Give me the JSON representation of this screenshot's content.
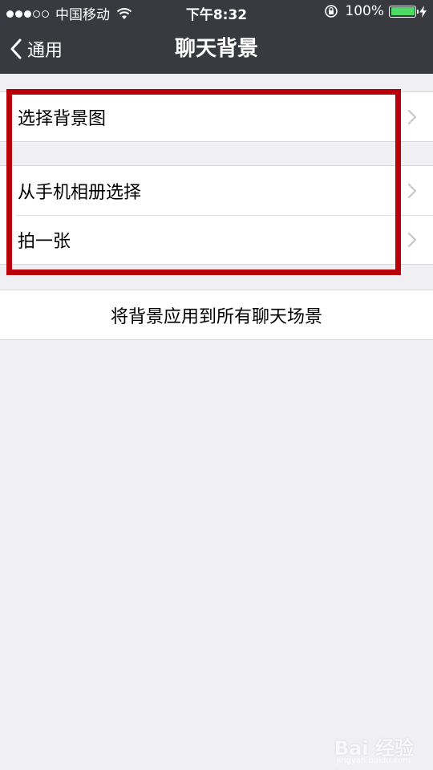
{
  "status_bar": {
    "carrier": "中国移动",
    "time": "下午8:32",
    "battery": "100%",
    "signal_dots_filled": 3,
    "signal_dots_total": 5
  },
  "nav": {
    "back_label": "通用",
    "title": "聊天背景"
  },
  "groups": {
    "choose": {
      "label": "选择背景图"
    },
    "album": {
      "label": "从手机相册选择"
    },
    "camera": {
      "label": "拍一张"
    },
    "apply_all": {
      "label": "将背景应用到所有聊天场景"
    }
  },
  "colors": {
    "nav_bg": "#393a3f",
    "page_bg": "#efeff4",
    "highlight": "#b8000a",
    "battery": "#4cd964"
  },
  "watermark": {
    "text": "Bai 经验",
    "sub": "jingyan.baidu.com"
  }
}
